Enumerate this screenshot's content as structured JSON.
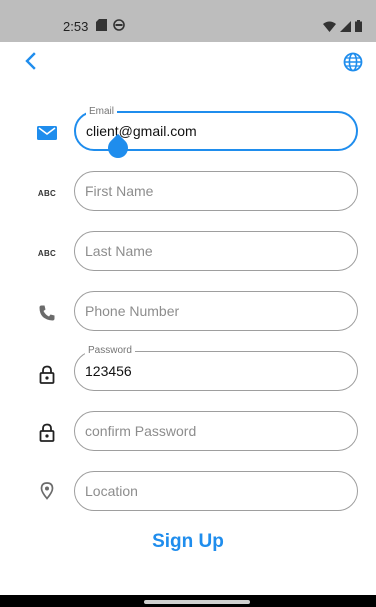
{
  "status_bar": {
    "time": "2:53"
  },
  "colors": {
    "accent": "#1f8ded",
    "status_bar_bg": "#bdbdbd",
    "border": "#9e9e9e"
  },
  "icons": {
    "back": "chevron-left-icon",
    "language": "globe-icon",
    "email": "mail-icon",
    "first_name": "abc-icon",
    "last_name": "abc-icon",
    "phone": "phone-icon",
    "password": "lock-icon",
    "confirm_password": "lock-icon",
    "location": "location-pin-icon"
  },
  "abc_text": "ABC",
  "form": {
    "email": {
      "label": "Email",
      "value": "client@gmail.com"
    },
    "first_name": {
      "placeholder": "First Name"
    },
    "last_name": {
      "placeholder": "Last Name"
    },
    "phone": {
      "placeholder": "Phone Number"
    },
    "password": {
      "label": "Password",
      "value": "123456"
    },
    "confirm_password": {
      "placeholder": "confirm Password"
    },
    "location": {
      "placeholder": "Location"
    }
  },
  "signup_label": "Sign Up"
}
